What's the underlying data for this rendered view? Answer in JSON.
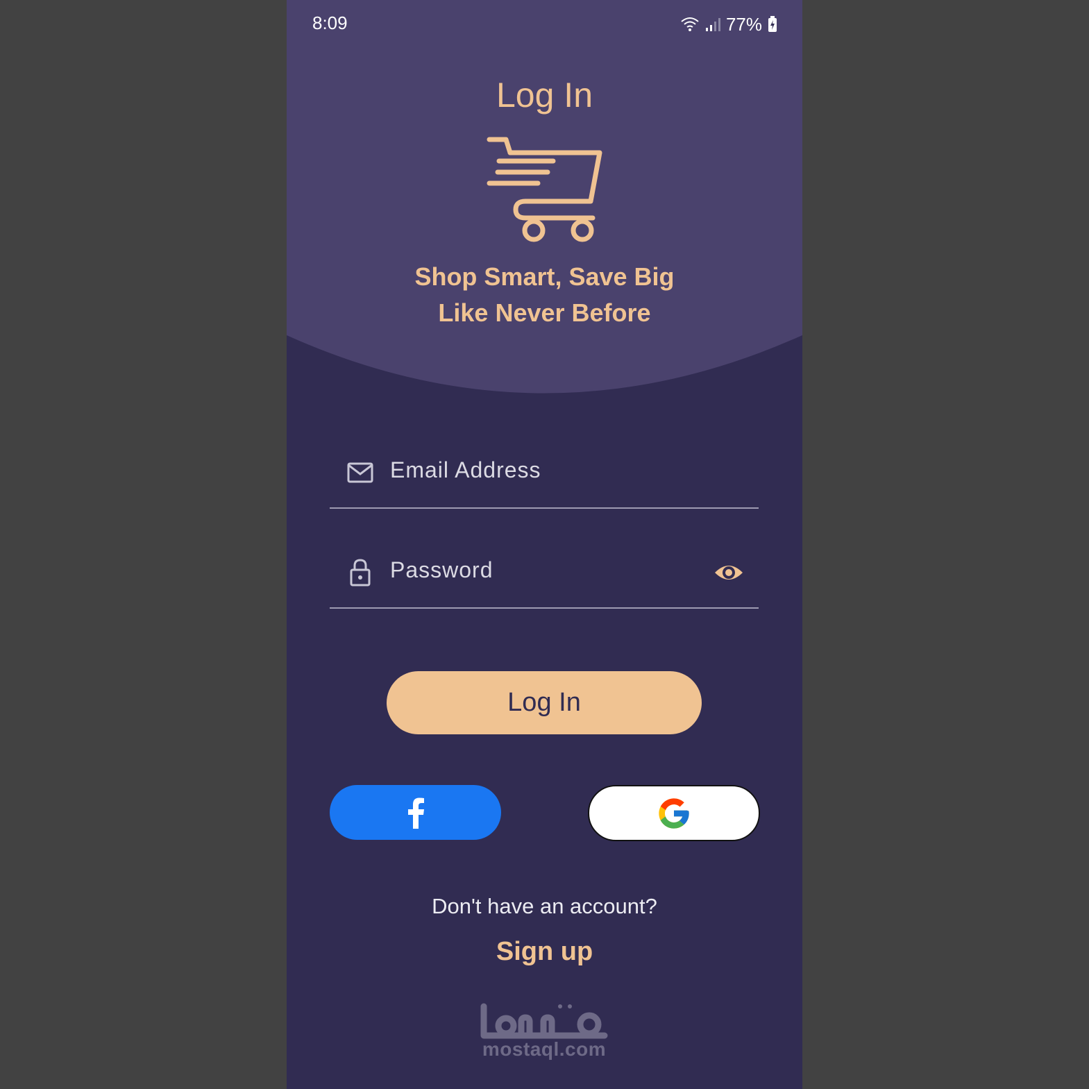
{
  "status_bar": {
    "time": "8:09",
    "battery": "77%"
  },
  "header": {
    "title": "Log In",
    "tagline_line1": "Shop Smart, Save Big",
    "tagline_line2": "Like Never Before",
    "logo_icon": "shopping-cart-icon"
  },
  "form": {
    "email": {
      "placeholder": "Email Address",
      "value": "",
      "icon": "mail-icon"
    },
    "password": {
      "placeholder": "Password",
      "value": "",
      "icon": "lock-icon",
      "toggle_icon": "eye-icon"
    }
  },
  "actions": {
    "login_label": "Log In",
    "facebook_icon": "facebook-icon",
    "google_icon": "google-icon"
  },
  "footer": {
    "no_account_text": "Don't have an account?",
    "signup_label": "Sign up"
  },
  "watermark": {
    "text": "mostaql.com"
  },
  "colors": {
    "background": "#424242",
    "screen": "#312c52",
    "header": "#4a426d",
    "accent": "#f0c392",
    "facebook": "#1a77f2",
    "google_bg": "#ffffff"
  }
}
